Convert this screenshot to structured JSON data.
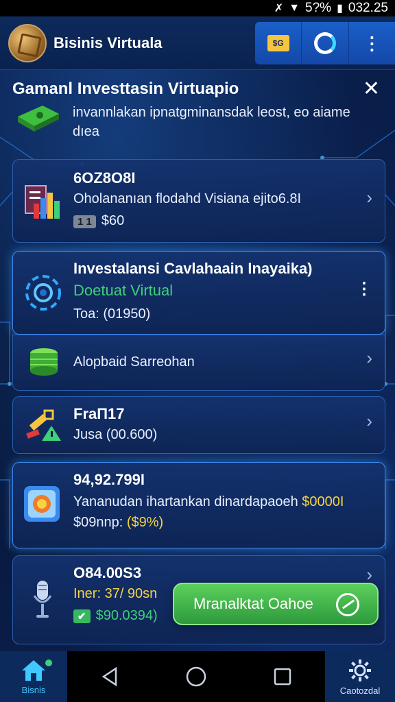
{
  "status_bar": {
    "battery": "5?%",
    "time": "032.25"
  },
  "app": {
    "title": "Bisinis Virtuala",
    "tag_label": "$G"
  },
  "header": {
    "title": "Gamanl Investtasin Virtuapio",
    "banner_text": "invannlakan ipnatgminansdak leost, eo aiame dıea"
  },
  "cards": [
    {
      "title": "6OZ8O8I",
      "subtitle": "Oholananıan flodahd Visiana ejito6.8I",
      "badge": "1 1",
      "price": "$60"
    },
    {
      "title": "Investalansi Cavlahaain Inayaika)",
      "subtitle": "Doetuat Virtual",
      "detail": "Toa: (01950)"
    },
    {
      "title": "Alopbaid Sarreohan"
    },
    {
      "title": "FraП17",
      "detail": "Jusa (00.600)"
    },
    {
      "title": "94,92.799I",
      "subtitle": "Yananudan ihartankan dinardapaoeh",
      "subtitle_amount": "$0000I",
      "detail_prefix": "$09nnp:",
      "detail_highlight": "($9%)"
    },
    {
      "title": "O84.00S3",
      "detail_prefix": "Iner: 37/ 90sn",
      "badge": "✔",
      "price": "$90.0394)"
    }
  ],
  "cta": {
    "label": "Mranalktat Oahoe"
  },
  "bottom_nav": {
    "home_label": "Bisnis",
    "settings_label": "Caotozdal"
  },
  "colors": {
    "accent": "#3a8af0",
    "green": "#3fd07a",
    "yellow": "#f5d342",
    "background": "#0a1a3a"
  }
}
